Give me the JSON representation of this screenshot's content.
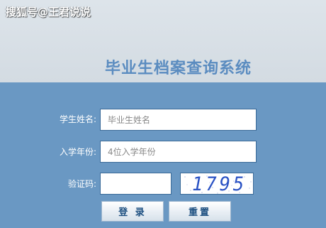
{
  "watermark": "搜狐号@王君说说",
  "title": "毕业生档案查询系统",
  "form": {
    "name_label": "学生姓名:",
    "name_placeholder": "毕业生姓名",
    "year_label": "入学年份:",
    "year_placeholder": "4位入学年份",
    "captcha_label": "验证码:",
    "captcha_value": "",
    "captcha_image_text": "1795"
  },
  "buttons": {
    "login": "登 录",
    "reset": "重置"
  },
  "colors": {
    "header_bg": "#d3dbe2",
    "body_bg": "#6a98c3",
    "title": "#5b8cc0",
    "button_text": "#1d4f80",
    "captcha_text": "#2a52c4"
  }
}
